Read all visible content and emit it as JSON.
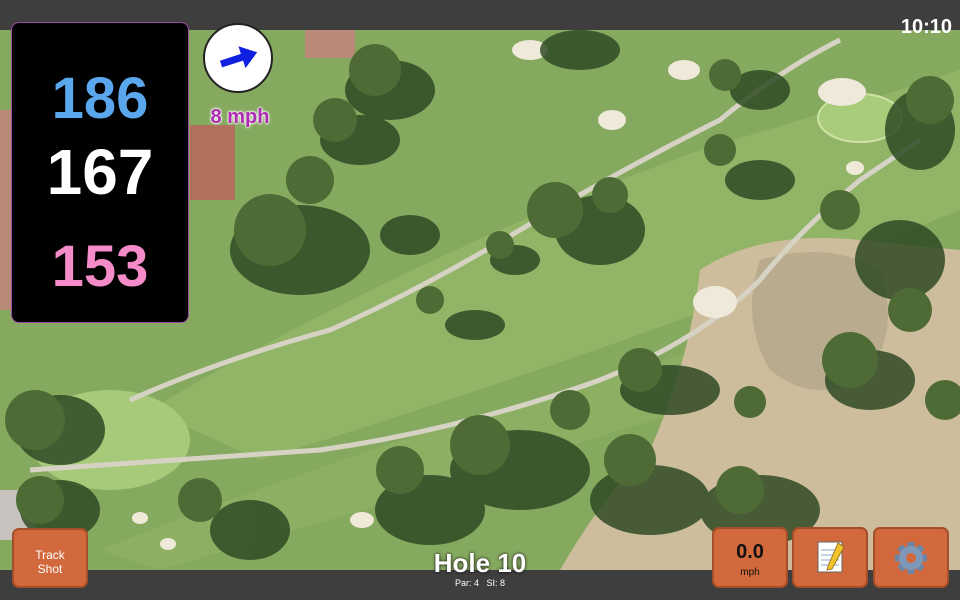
{
  "status_bar": {
    "time": "10:10"
  },
  "distances": {
    "back": "186",
    "middle": "167",
    "front": "153"
  },
  "wind": {
    "speed_label": "8 mph",
    "direction_icon": "wind-arrow-icon"
  },
  "hole": {
    "title": "Hole 10",
    "par_label": "Par: 4",
    "si_label": "SI: 8"
  },
  "buttons": {
    "track_shot": "Track\nShot",
    "speed_value": "0.0",
    "speed_unit": "mph",
    "notes_icon": "notepad-icon",
    "settings_icon": "gear-icon"
  },
  "colors": {
    "back_distance": "#5ba7ee",
    "middle_distance": "#ffffff",
    "front_distance": "#f58bc8",
    "button_orange": "#d2693c",
    "wind_text": "#b02bb5"
  }
}
